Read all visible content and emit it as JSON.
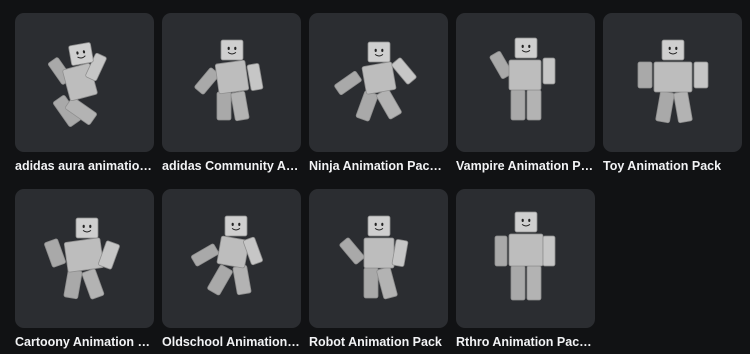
{
  "items": [
    {
      "name": "adidas aura animation ...",
      "icon": "avatar-figure-icon",
      "pose": "aura"
    },
    {
      "name": "adidas Community Ani...",
      "icon": "avatar-figure-icon",
      "pose": "community"
    },
    {
      "name": "Ninja Animation Package",
      "icon": "avatar-figure-icon",
      "pose": "ninja"
    },
    {
      "name": "Vampire Animation Pack",
      "icon": "avatar-figure-icon",
      "pose": "vampire"
    },
    {
      "name": "Toy Animation Pack",
      "icon": "avatar-figure-icon",
      "pose": "toy"
    },
    {
      "name": "Cartoony Animation Pa...",
      "icon": "avatar-figure-icon",
      "pose": "cartoony"
    },
    {
      "name": "Oldschool Animation P...",
      "icon": "avatar-figure-icon",
      "pose": "oldschool"
    },
    {
      "name": "Robot Animation Pack",
      "icon": "avatar-figure-icon",
      "pose": "robot"
    },
    {
      "name": "Rthro Animation Packa...",
      "icon": "avatar-figure-icon",
      "pose": "rthro"
    }
  ],
  "colors": {
    "background": "#111214",
    "card": "#2b2d31",
    "text": "#f2f3f5",
    "figure": "#bdbdbd"
  }
}
